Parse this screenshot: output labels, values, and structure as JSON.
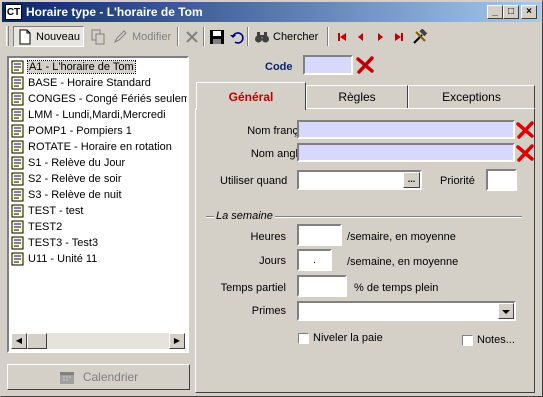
{
  "window": {
    "title": "Horaire type - L'horaire de Tom",
    "app_icon_text": "CT"
  },
  "toolbar": {
    "nouveau": "Nouveau",
    "modifier": "Modifier",
    "chercher": "Chercher"
  },
  "list": {
    "items": [
      "A1 - L'horaire de Tom",
      "BASE - Horaire Standard",
      "CONGES - Congé Fériés seulem",
      "LMM - Lundi,Mardi,Mercredi",
      "POMP1 - Pompiers 1",
      "ROTATE - Horaire en rotation",
      "S1 - Relève du Jour",
      "S2 - Relève de soir",
      "S3 - Relève de nuit",
      "TEST - test",
      "TEST2",
      "TEST3 - Test3",
      "U11 - Unité 11"
    ]
  },
  "calendar_button": "Calendrier",
  "form": {
    "code_label": "Code",
    "code_value": "",
    "tabs": [
      "Général",
      "Règles",
      "Exceptions"
    ],
    "nom_francais_label": "Nom français",
    "nom_anglais_label": "Nom anglais",
    "utiliser_quand_label": "Utiliser quand",
    "ellipsis": "...",
    "priorite_label": "Priorité",
    "semaine_legend": "La semaine",
    "heures_label": "Heures",
    "heures_suffix": "/semaire, en moyenne",
    "jours_label": "Jours",
    "jours_value": ".",
    "jours_suffix": "/semaine, en moyenne",
    "temps_partiel_label": "Temps partiel",
    "temps_partiel_suffix": "% de temps plein",
    "primes_label": "Primes",
    "niveler_label": "Niveler la paie",
    "notes_label": "Notes..."
  },
  "colors": {
    "required_field": "#d8d8ff",
    "active_tab_text": "#c00000",
    "code_label": "#0a246a"
  }
}
